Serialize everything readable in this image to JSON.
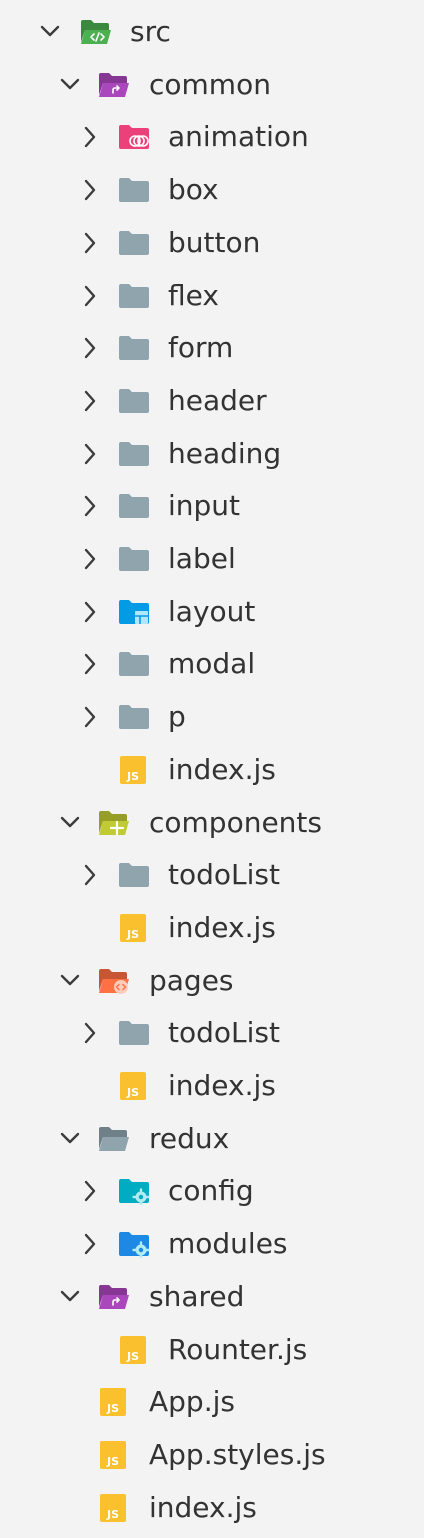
{
  "explorer": {
    "items": [
      {
        "id": "src",
        "label": "src",
        "depth": 0,
        "type": "folder",
        "expanded": true,
        "icon": "folder-src-open-icon",
        "color": "#4caf50"
      },
      {
        "id": "common",
        "label": "common",
        "depth": 1,
        "type": "folder",
        "expanded": true,
        "icon": "folder-shared-open-icon",
        "color": "#ab47bc"
      },
      {
        "id": "animation",
        "label": "animation",
        "depth": 2,
        "type": "folder",
        "expanded": false,
        "icon": "folder-animation-icon",
        "color": "#ec407a"
      },
      {
        "id": "box",
        "label": "box",
        "depth": 2,
        "type": "folder",
        "expanded": false,
        "icon": "folder-icon",
        "color": "#90a4ae"
      },
      {
        "id": "button",
        "label": "button",
        "depth": 2,
        "type": "folder",
        "expanded": false,
        "icon": "folder-icon",
        "color": "#90a4ae"
      },
      {
        "id": "flex",
        "label": "flex",
        "depth": 2,
        "type": "folder",
        "expanded": false,
        "icon": "folder-icon",
        "color": "#90a4ae"
      },
      {
        "id": "form",
        "label": "form",
        "depth": 2,
        "type": "folder",
        "expanded": false,
        "icon": "folder-icon",
        "color": "#90a4ae"
      },
      {
        "id": "header",
        "label": "header",
        "depth": 2,
        "type": "folder",
        "expanded": false,
        "icon": "folder-icon",
        "color": "#90a4ae"
      },
      {
        "id": "heading",
        "label": "heading",
        "depth": 2,
        "type": "folder",
        "expanded": false,
        "icon": "folder-icon",
        "color": "#90a4ae"
      },
      {
        "id": "input",
        "label": "input",
        "depth": 2,
        "type": "folder",
        "expanded": false,
        "icon": "folder-icon",
        "color": "#90a4ae"
      },
      {
        "id": "label",
        "label": "label",
        "depth": 2,
        "type": "folder",
        "expanded": false,
        "icon": "folder-icon",
        "color": "#90a4ae"
      },
      {
        "id": "layout",
        "label": "layout",
        "depth": 2,
        "type": "folder",
        "expanded": false,
        "icon": "folder-layout-icon",
        "color": "#039be5"
      },
      {
        "id": "modal",
        "label": "modal",
        "depth": 2,
        "type": "folder",
        "expanded": false,
        "icon": "folder-icon",
        "color": "#90a4ae"
      },
      {
        "id": "p",
        "label": "p",
        "depth": 2,
        "type": "folder",
        "expanded": false,
        "icon": "folder-icon",
        "color": "#90a4ae"
      },
      {
        "id": "common-index",
        "label": "index.js",
        "depth": 2,
        "type": "file",
        "icon": "js-file-icon",
        "color": "#fbc02d"
      },
      {
        "id": "components",
        "label": "components",
        "depth": 1,
        "type": "folder",
        "expanded": true,
        "icon": "folder-components-open-icon",
        "color": "#c0ca33"
      },
      {
        "id": "components-todolist",
        "label": "todoList",
        "depth": 2,
        "type": "folder",
        "expanded": false,
        "icon": "folder-icon",
        "color": "#90a4ae"
      },
      {
        "id": "components-index",
        "label": "index.js",
        "depth": 2,
        "type": "file",
        "icon": "js-file-icon",
        "color": "#fbc02d"
      },
      {
        "id": "pages",
        "label": "pages",
        "depth": 1,
        "type": "folder",
        "expanded": true,
        "icon": "folder-views-open-icon",
        "color": "#ff7043"
      },
      {
        "id": "pages-todolist",
        "label": "todoList",
        "depth": 2,
        "type": "folder",
        "expanded": false,
        "icon": "folder-icon",
        "color": "#90a4ae"
      },
      {
        "id": "pages-index",
        "label": "index.js",
        "depth": 2,
        "type": "file",
        "icon": "js-file-icon",
        "color": "#fbc02d"
      },
      {
        "id": "redux",
        "label": "redux",
        "depth": 1,
        "type": "folder",
        "expanded": true,
        "icon": "folder-open-icon",
        "color": "#90a4ae"
      },
      {
        "id": "config",
        "label": "config",
        "depth": 2,
        "type": "folder",
        "expanded": false,
        "icon": "folder-config-icon",
        "color": "#00acc1"
      },
      {
        "id": "modules",
        "label": "modules",
        "depth": 2,
        "type": "folder",
        "expanded": false,
        "icon": "folder-modules-icon",
        "color": "#1e88e5"
      },
      {
        "id": "shared",
        "label": "shared",
        "depth": 1,
        "type": "folder",
        "expanded": true,
        "icon": "folder-shared-open-icon",
        "color": "#ab47bc"
      },
      {
        "id": "router",
        "label": "Rounter.js",
        "depth": 2,
        "type": "file",
        "icon": "js-file-icon",
        "color": "#fbc02d"
      },
      {
        "id": "app",
        "label": "App.js",
        "depth": 1,
        "type": "file",
        "icon": "js-file-icon",
        "color": "#fbc02d"
      },
      {
        "id": "app-styles",
        "label": "App.styles.js",
        "depth": 1,
        "type": "file",
        "icon": "js-file-icon",
        "color": "#fbc02d"
      },
      {
        "id": "src-index",
        "label": "index.js",
        "depth": 1,
        "type": "file",
        "icon": "js-file-icon",
        "color": "#fbc02d"
      }
    ],
    "js_badge_text": "JS",
    "chevron_color": "#3c3c3c",
    "text_color": "#333333",
    "background": "#f3f3f3"
  }
}
